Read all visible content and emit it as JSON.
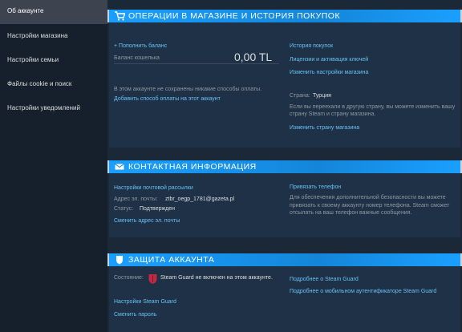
{
  "sidebar": {
    "items": [
      {
        "label": "Об аккаунте"
      },
      {
        "label": "Настройки магазина"
      },
      {
        "label": "Настройки семьи"
      },
      {
        "label": "Файлы cookie и поиск"
      },
      {
        "label": "Настройки уведомлений"
      }
    ]
  },
  "store": {
    "title": "ОПЕРАЦИИ В МАГАЗИНЕ И ИСТОРИЯ ПОКУПОК",
    "add_funds": "+ Пополнить баланс",
    "wallet_label": "Баланс кошелька",
    "wallet_amount": "0,00 TL",
    "payment_note": "В этом аккаунте не сохранены никакие способы оплаты.",
    "add_payment": "Добавить способ оплаты на этот аккаунт",
    "links": [
      "История покупок",
      "Лицензии и активация ключей",
      "Изменить настройки магазина"
    ],
    "country_label": "Страна:",
    "country_value": "Турция",
    "country_note": "Если вы переехали в другую страну, вы можете изменить вашу страну Steam и страну магазина.",
    "change_country": "Изменить страну магазина"
  },
  "contact": {
    "title": "КОНТАКТНАЯ ИНФОРМАЦИЯ",
    "email_prefs": "Настройки почтовой рассылки",
    "email_label": "Адрес эл. почты:",
    "email_value": "ztbr_oegp_1781@gazeta.pl",
    "status_label": "Статус:",
    "status_value": "Подтвержден",
    "change_email": "Сменить адрес эл. почты",
    "add_phone": "Привязать телефон",
    "phone_note": "Для обеспечения дополнительной безопасности вы можете привязать к своему аккаунту номер телефона. Steam сможет отсылать на ваш телефон важные сообщения."
  },
  "security": {
    "title": "ЗАЩИТА АККАУНТА",
    "state_label": "Состояние:",
    "guard_status": "Steam Guard не включен на этом аккаунте.",
    "guard_settings": "Настройки Steam Guard",
    "change_password": "Сменить пароль",
    "more_guard": "Подробнее о Steam Guard",
    "more_mobile": "Подробнее о мобильном аутентификаторе Steam Guard"
  }
}
